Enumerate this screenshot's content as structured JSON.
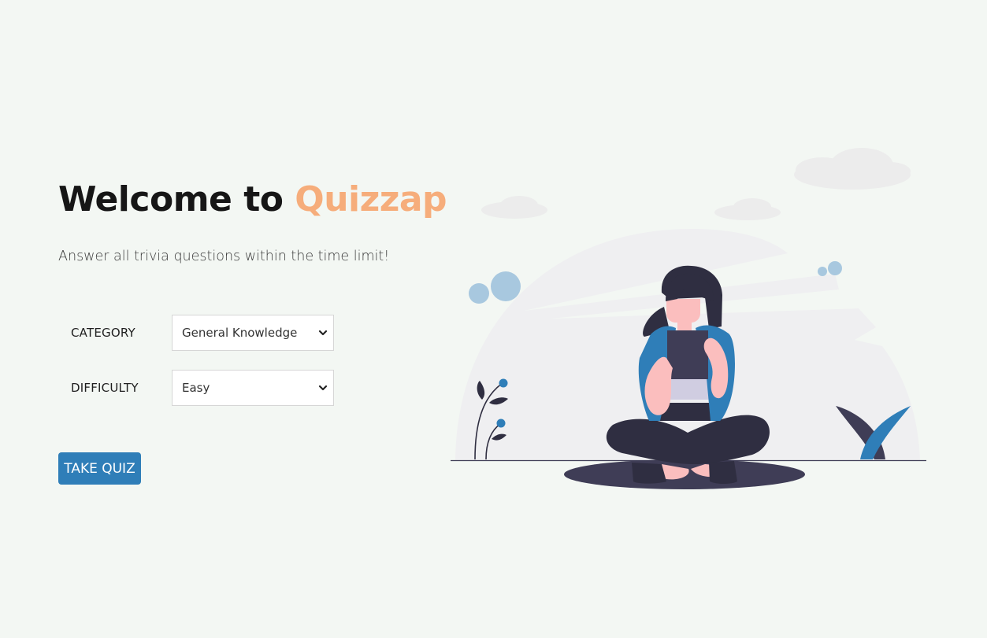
{
  "hero": {
    "title_prefix": "Welcome to ",
    "title_brand": "Quizzap",
    "subtitle": "Answer all trivia questions within the time limit!"
  },
  "form": {
    "category": {
      "label": "CATEGORY",
      "selected": "General Knowledge"
    },
    "difficulty": {
      "label": "DIFFICULTY",
      "selected": "Easy"
    },
    "submit_label": "TAKE QUIZ"
  },
  "illustration": {
    "icon": "woman-reading-tablet-illustration"
  },
  "colors": {
    "background": "#f3f7f3",
    "brand_accent": "#f6ad7b",
    "primary_button": "#2f7eb8",
    "title_text": "#161616"
  }
}
